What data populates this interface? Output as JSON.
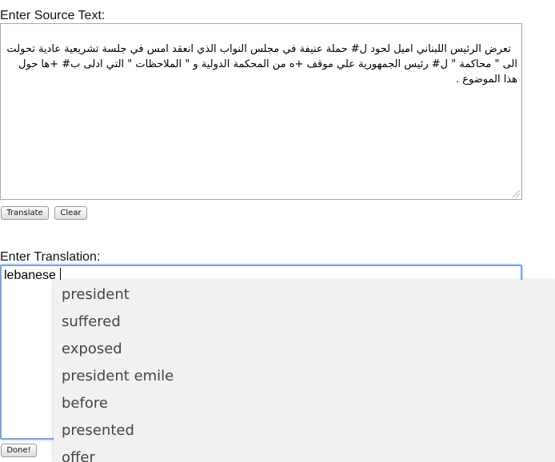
{
  "source": {
    "label": "Enter Source Text:",
    "text": "تعرض الرئيس اللبناني اميل لحود ل# حملة عنيفة في مجلس النواب الذي انعقد امس في جلسة تشريعية عادية تحولت الى \" محاكمة \" ل# رئيس الجمهورية علي موقف +ه من المحكمة الدولية و \" الملاحظات \" التي ادلى ب# +ها حول هذا الموضوع ."
  },
  "buttons": {
    "translate": "Translate",
    "clear": "Clear",
    "done": "Done!"
  },
  "translation": {
    "label": "Enter Translation:",
    "value": "lebanese"
  },
  "autocomplete": {
    "suggestions": [
      "president",
      "suffered",
      "exposed",
      "president emile",
      "before",
      "presented",
      "offer"
    ]
  }
}
